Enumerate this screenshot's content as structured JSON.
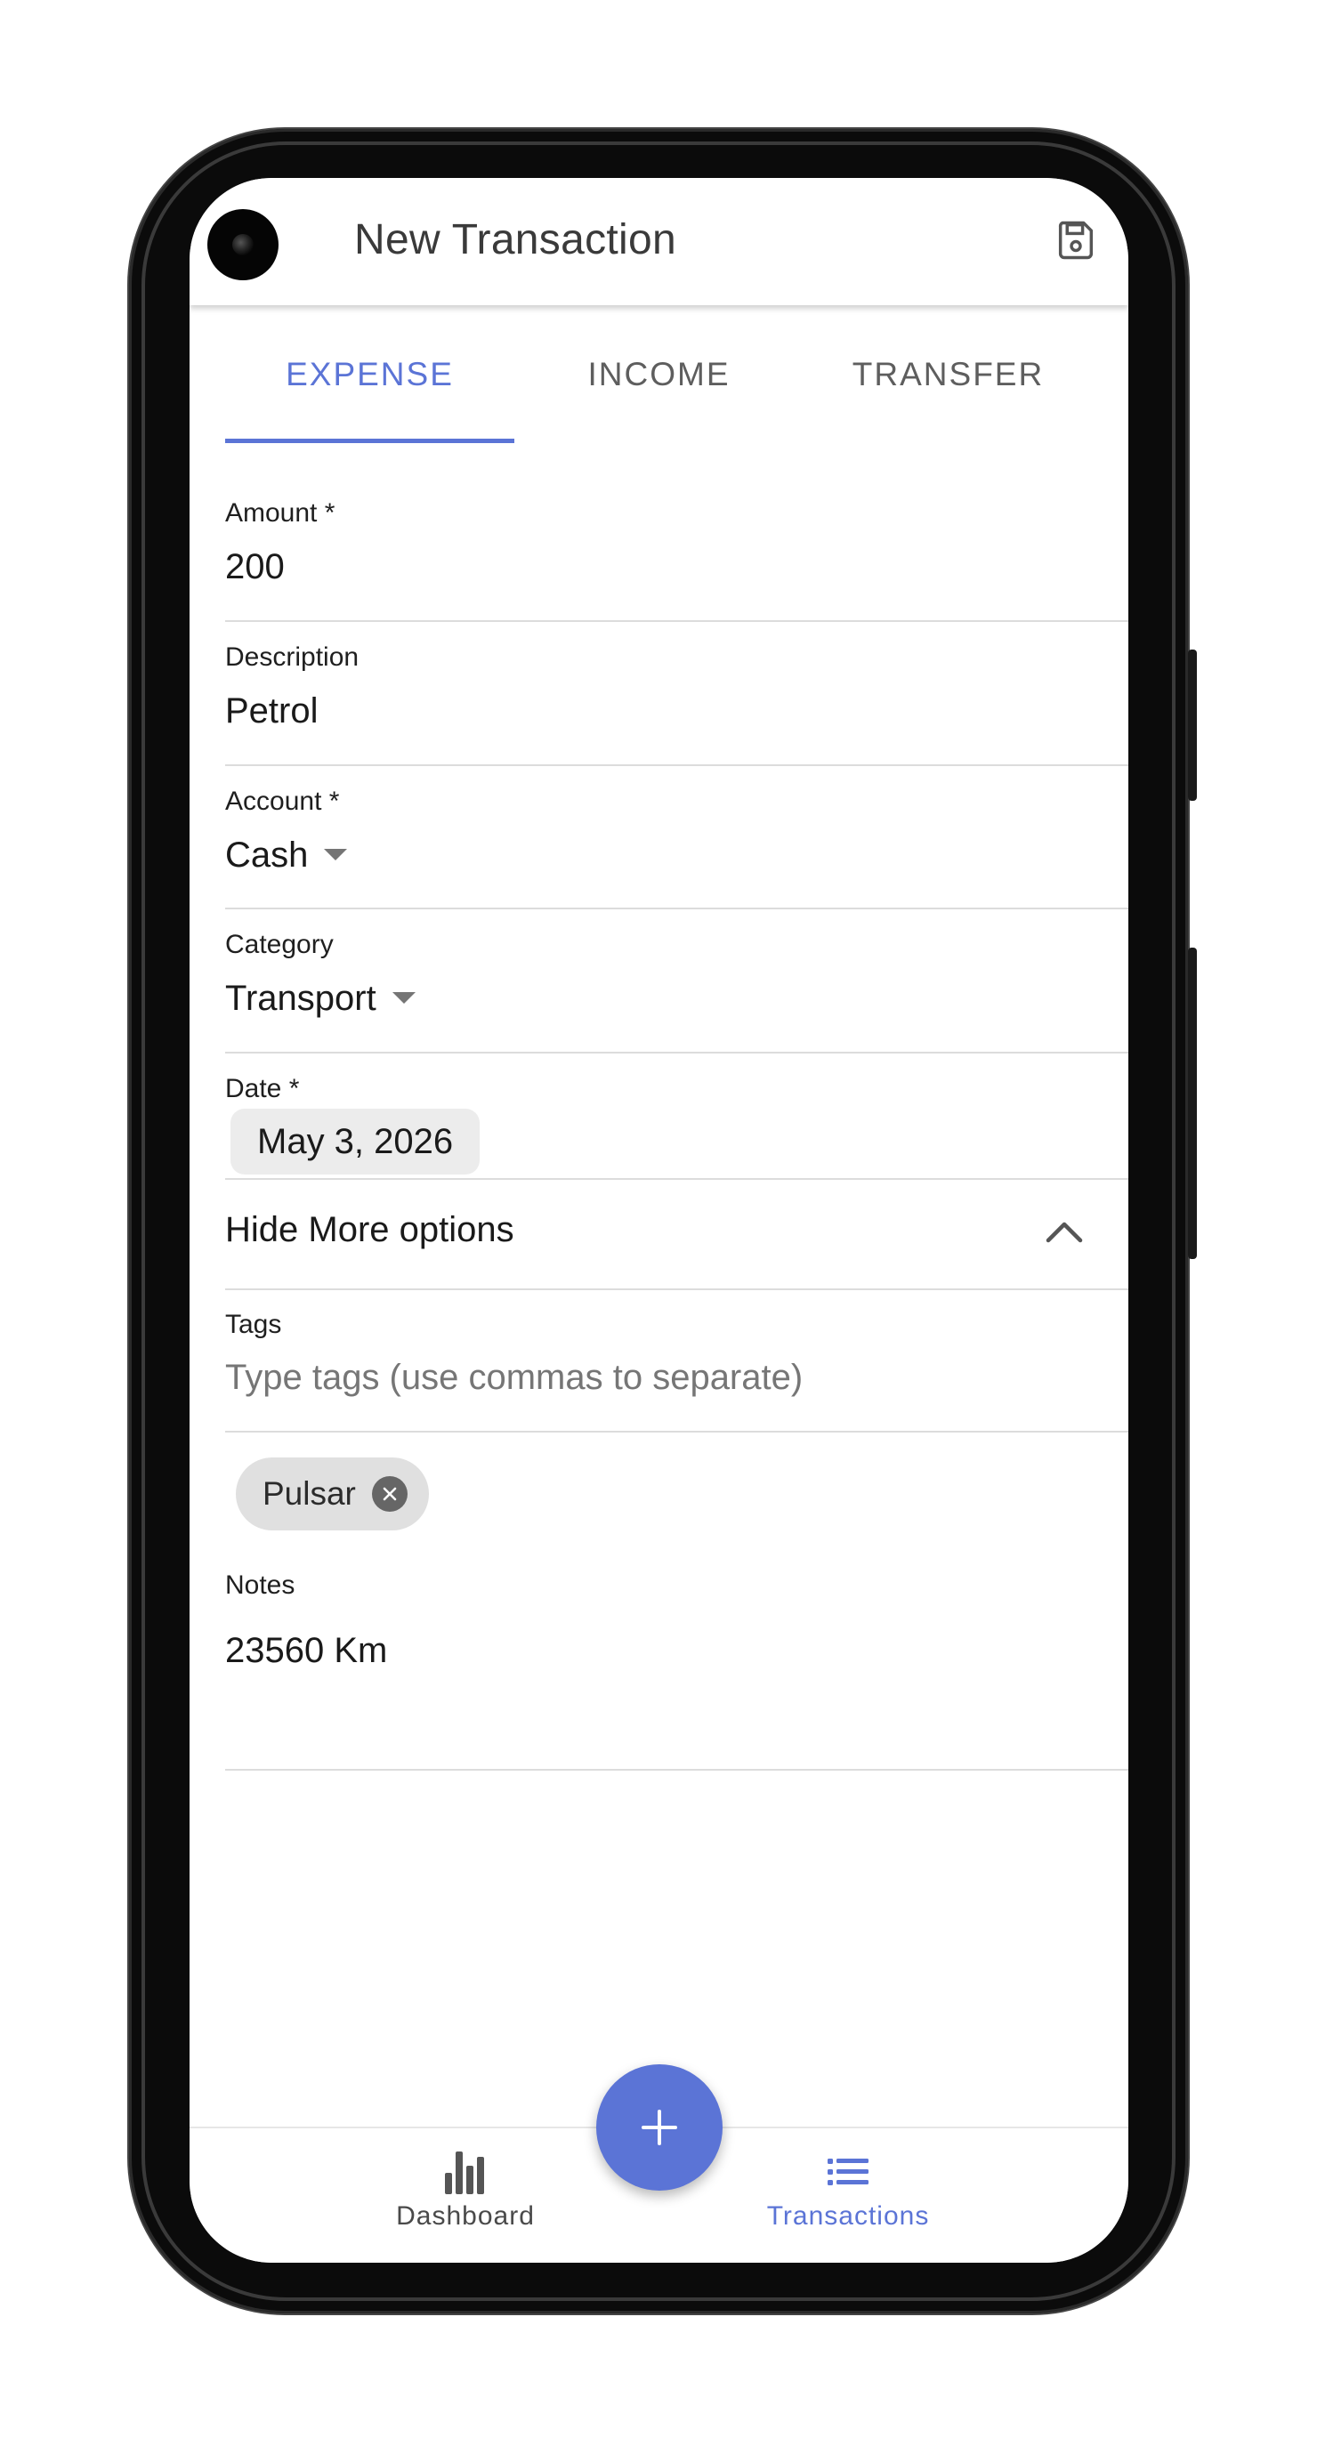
{
  "app_bar": {
    "title": "New Transaction",
    "save_icon": "save-icon"
  },
  "tabs": [
    {
      "label": "EXPENSE",
      "active": true
    },
    {
      "label": "INCOME",
      "active": false
    },
    {
      "label": "TRANSFER",
      "active": false
    }
  ],
  "form": {
    "amount": {
      "label": "Amount *",
      "value": "200"
    },
    "description": {
      "label": "Description",
      "value": "Petrol"
    },
    "account": {
      "label": "Account *",
      "value": "Cash"
    },
    "category": {
      "label": "Category",
      "value": "Transport"
    },
    "date": {
      "label": "Date *",
      "value": "May 3, 2026"
    },
    "more_options": {
      "label": "Hide More options"
    },
    "tags": {
      "label": "Tags",
      "placeholder": "Type tags (use commas to separate)",
      "chips": [
        "Pulsar"
      ]
    },
    "notes": {
      "label": "Notes",
      "value": "23560 Km"
    }
  },
  "bottom_nav": {
    "items": [
      {
        "label": "Dashboard",
        "icon": "bar-chart-icon",
        "active": false
      },
      {
        "label": "Transactions",
        "icon": "list-icon",
        "active": true
      }
    ],
    "fab_icon": "plus-icon"
  },
  "colors": {
    "accent": "#5b74d6",
    "inactive_text": "#5e5e5e",
    "divider": "#dcdcdc"
  }
}
